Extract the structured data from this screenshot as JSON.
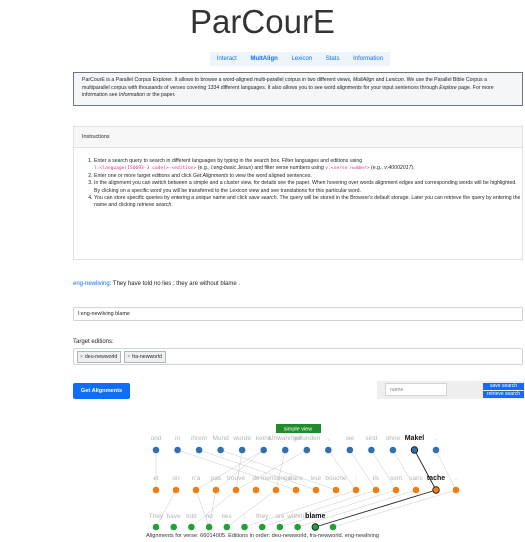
{
  "title": "ParCourE",
  "nav": [
    "Interact",
    "MultAlign",
    "Lexicon",
    "Stats",
    "Information"
  ],
  "nav_active": 1,
  "intro": {
    "p1": "ParCourE is a Parallel Corpus Explorer. It allows to browse a word-aligned multi-parallel corpus in two different views, ",
    "v1": "MultAlign",
    "p2": " and ",
    "v2": "Lexicon",
    "p3": ". We use the Parallel Bible Corpus a multiparallel corpus with thousands of verses covering 1334 different languages. It also allows you to see word alignments for your input sentences through ",
    "v3": "Explore",
    "p4": " page. For more information see ",
    "v4": "Information",
    "p5": " or the paper."
  },
  "instructions": {
    "title": "Instructions",
    "i1a": "Enter a search query to search in different languages by typing in the search box. Filter languages and editions using",
    "i1code1": "l:<language(ISO693-3 code)>-<edition>",
    "i1b": " (e.g., ",
    "i1eg1": "l:eng-basic Jesus",
    "i1c": ") and filter verse numbers using ",
    "i1code2": "v:<verse number>",
    "i1d": " (e.g., ",
    "i1eg2": "v:40002017",
    "i1e": ").",
    "i2a": "Enter one or more target editions and click ",
    "i2em": "Get Alignments",
    "i2b": " to view the word aligned sentences.",
    "i3": "In the alignment you can switch between a simple and a cluster view, for details see the paper. When hovering over words alignment edges and corresponding words will be highlighted. By clicking on a specific word you will be transferred to the Lexicon view and see translations for this particular word.",
    "i4a": "You can store specific queries by entering a unique name and click ",
    "i4em1": "save search",
    "i4b": ". The query will be stored in the Browser's default storage. Later you can retrieve the query by entering the name and clicking ",
    "i4em2": "retrieve search",
    "i4c": "."
  },
  "verse": {
    "edition": "eng-newliving",
    "text": ": They have told no lies ; they are without blame ."
  },
  "query_value": "l:eng-newliving blame",
  "target_label": "Target editions:",
  "targets": [
    "deu-newworld",
    "fra-newworld"
  ],
  "chip_remove": "×",
  "buttons": {
    "get": "Get Alignments",
    "save": "save search",
    "retrieve": "retrieve search"
  },
  "name_placeholder": "name",
  "view_toggle": "simple view",
  "alignment": {
    "de": [
      "und",
      "in",
      "ihrem",
      "Mund",
      "wurde",
      "keine",
      "Unwahrheit",
      "gefunden",
      ",",
      "sie",
      "sind",
      "ohne",
      "Makel",
      "."
    ],
    "fr": [
      "et",
      "on",
      "n'a",
      "pas",
      "trouvé",
      "de",
      "mensonge",
      "dans",
      "leur",
      "bouche",
      ";",
      "ils",
      "sont",
      "sans",
      "tache",
      "."
    ],
    "en": [
      "They",
      "have",
      "told",
      "no",
      "lies",
      ";",
      "they",
      "are",
      "without",
      "blame",
      "."
    ],
    "highlight": {
      "de": 12,
      "fr": 14,
      "en": 9
    },
    "colors": {
      "de": "#2f6fb3",
      "fr": "#f07d14",
      "en": "#23a033"
    }
  },
  "footer": "Alignments for verse: 66014005. Editions in order: deu-newworld, fra-newworld, eng-newliving"
}
